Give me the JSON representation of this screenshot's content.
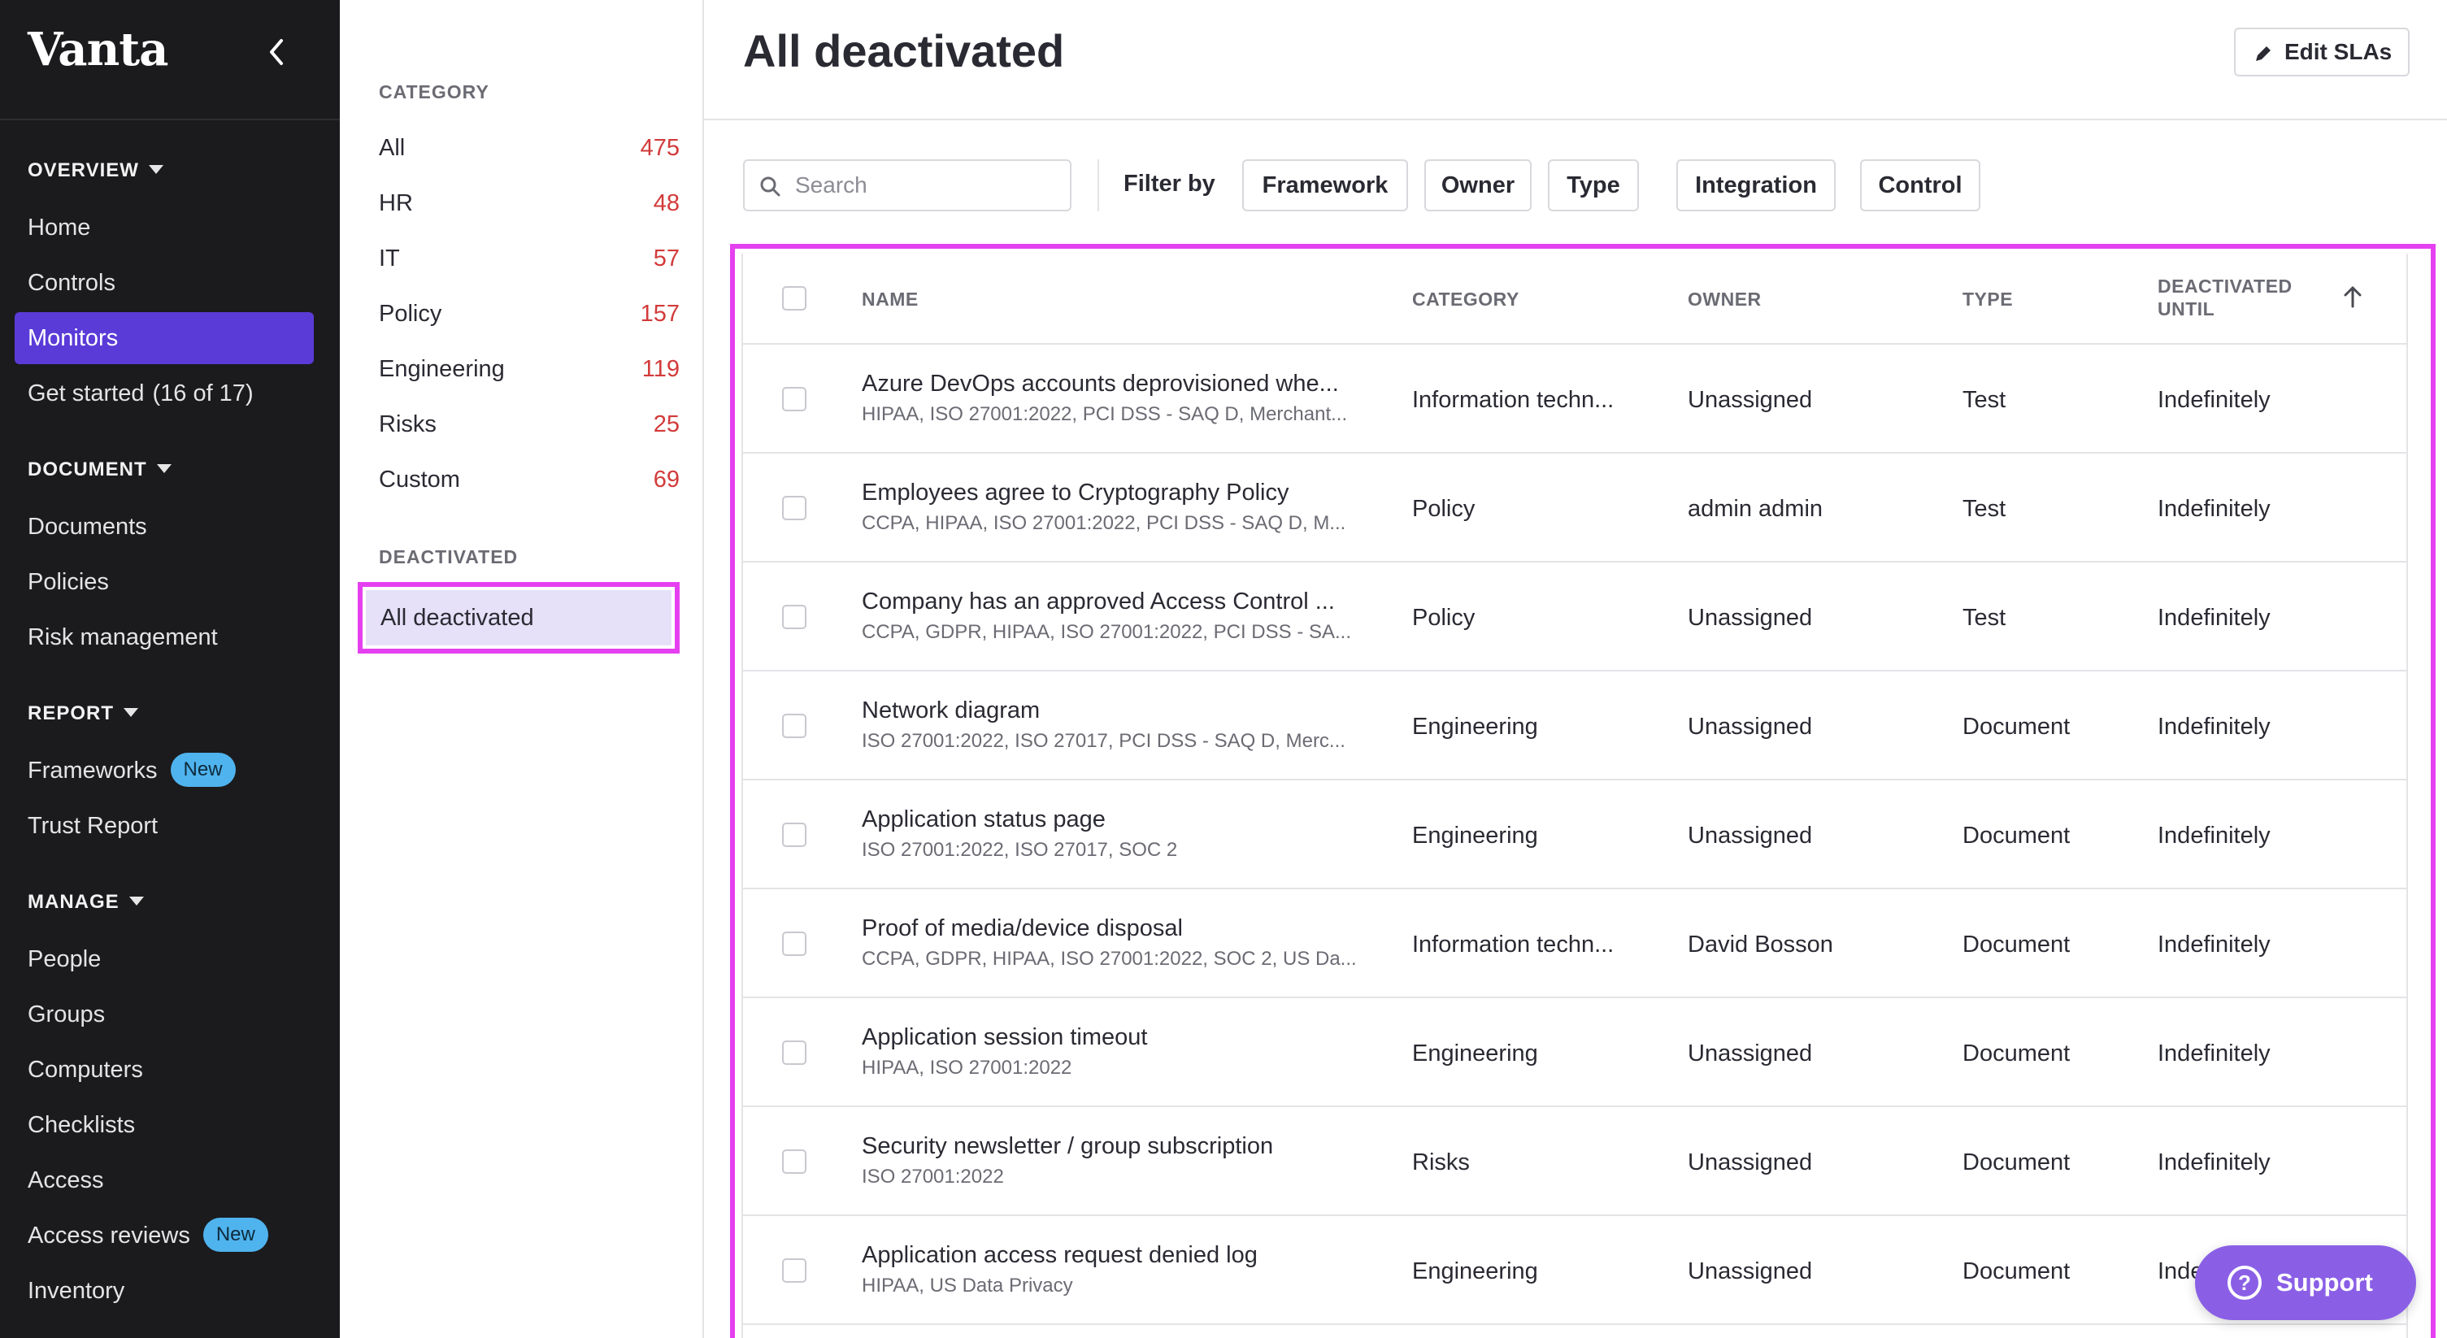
{
  "nav": {
    "brand": "Vanta",
    "sections": [
      {
        "title": "OVERVIEW",
        "items": [
          {
            "label": "Home"
          },
          {
            "label": "Controls"
          },
          {
            "label": "Monitors"
          },
          {
            "label": "Get started",
            "extra": "(16 of 17)"
          }
        ]
      },
      {
        "title": "DOCUMENT",
        "items": [
          {
            "label": "Documents"
          },
          {
            "label": "Policies"
          },
          {
            "label": "Risk management"
          }
        ]
      },
      {
        "title": "REPORT",
        "items": [
          {
            "label": "Frameworks",
            "badge": "New"
          },
          {
            "label": "Trust Report"
          }
        ]
      },
      {
        "title": "MANAGE",
        "items": [
          {
            "label": "People"
          },
          {
            "label": "Groups"
          },
          {
            "label": "Computers"
          },
          {
            "label": "Checklists"
          },
          {
            "label": "Access"
          },
          {
            "label": "Access reviews",
            "badge": "New"
          },
          {
            "label": "Inventory"
          }
        ]
      }
    ],
    "active_item": "Monitors"
  },
  "categories": {
    "heading": "CATEGORY",
    "items": [
      {
        "label": "All",
        "count": "475"
      },
      {
        "label": "HR",
        "count": "48"
      },
      {
        "label": "IT",
        "count": "57"
      },
      {
        "label": "Policy",
        "count": "157"
      },
      {
        "label": "Engineering",
        "count": "119"
      },
      {
        "label": "Risks",
        "count": "25"
      },
      {
        "label": "Custom",
        "count": "69"
      }
    ],
    "deactivated_heading": "DEACTIVATED",
    "deactivated_item": "All deactivated"
  },
  "main": {
    "title": "All deactivated",
    "edit_sla_label": "Edit SLAs",
    "search_placeholder": "Search",
    "filter_label": "Filter by",
    "filters": [
      "Framework",
      "Owner",
      "Type",
      "Integration",
      "Control"
    ]
  },
  "table": {
    "columns": {
      "name": "NAME",
      "category": "CATEGORY",
      "owner": "OWNER",
      "type": "TYPE",
      "deactivated_1": "DEACTIVATED",
      "deactivated_2": "UNTIL"
    },
    "rows": [
      {
        "name": "Azure DevOps accounts deprovisioned whe...",
        "frameworks": "HIPAA, ISO 27001:2022, PCI DSS - SAQ D, Merchant...",
        "category": "Information techn...",
        "owner": "Unassigned",
        "type": "Test",
        "until": "Indefinitely"
      },
      {
        "name": "Employees agree to Cryptography Policy",
        "frameworks": "CCPA, HIPAA, ISO 27001:2022, PCI DSS - SAQ D, M...",
        "category": "Policy",
        "owner": "admin admin",
        "type": "Test",
        "until": "Indefinitely"
      },
      {
        "name": "Company has an approved Access Control ...",
        "frameworks": "CCPA, GDPR, HIPAA, ISO 27001:2022, PCI DSS - SA...",
        "category": "Policy",
        "owner": "Unassigned",
        "type": "Test",
        "until": "Indefinitely"
      },
      {
        "name": "Network diagram",
        "frameworks": "ISO 27001:2022, ISO 27017, PCI DSS - SAQ D, Merc...",
        "category": "Engineering",
        "owner": "Unassigned",
        "type": "Document",
        "until": "Indefinitely"
      },
      {
        "name": "Application status page",
        "frameworks": "ISO 27001:2022, ISO 27017, SOC 2",
        "category": "Engineering",
        "owner": "Unassigned",
        "type": "Document",
        "until": "Indefinitely"
      },
      {
        "name": "Proof of media/device disposal",
        "frameworks": "CCPA, GDPR, HIPAA, ISO 27001:2022, SOC 2, US Da...",
        "category": "Information techn...",
        "owner": "David Bosson",
        "type": "Document",
        "until": "Indefinitely"
      },
      {
        "name": "Application session timeout",
        "frameworks": "HIPAA, ISO 27001:2022",
        "category": "Engineering",
        "owner": "Unassigned",
        "type": "Document",
        "until": "Indefinitely"
      },
      {
        "name": "Security newsletter / group subscription",
        "frameworks": "ISO 27001:2022",
        "category": "Risks",
        "owner": "Unassigned",
        "type": "Document",
        "until": "Indefinitely"
      },
      {
        "name": "Application access request denied log",
        "frameworks": "HIPAA, US Data Privacy",
        "category": "Engineering",
        "owner": "Unassigned",
        "type": "Document",
        "until": "Inde"
      }
    ]
  },
  "support_label": "Support",
  "colors": {
    "nav_bg": "#1b1b1d",
    "active": "#5a3bd8",
    "badge": "#4fb3ee",
    "count": "#d23a3a",
    "highlight": "#e540f0",
    "support": "#8a5fe6"
  }
}
